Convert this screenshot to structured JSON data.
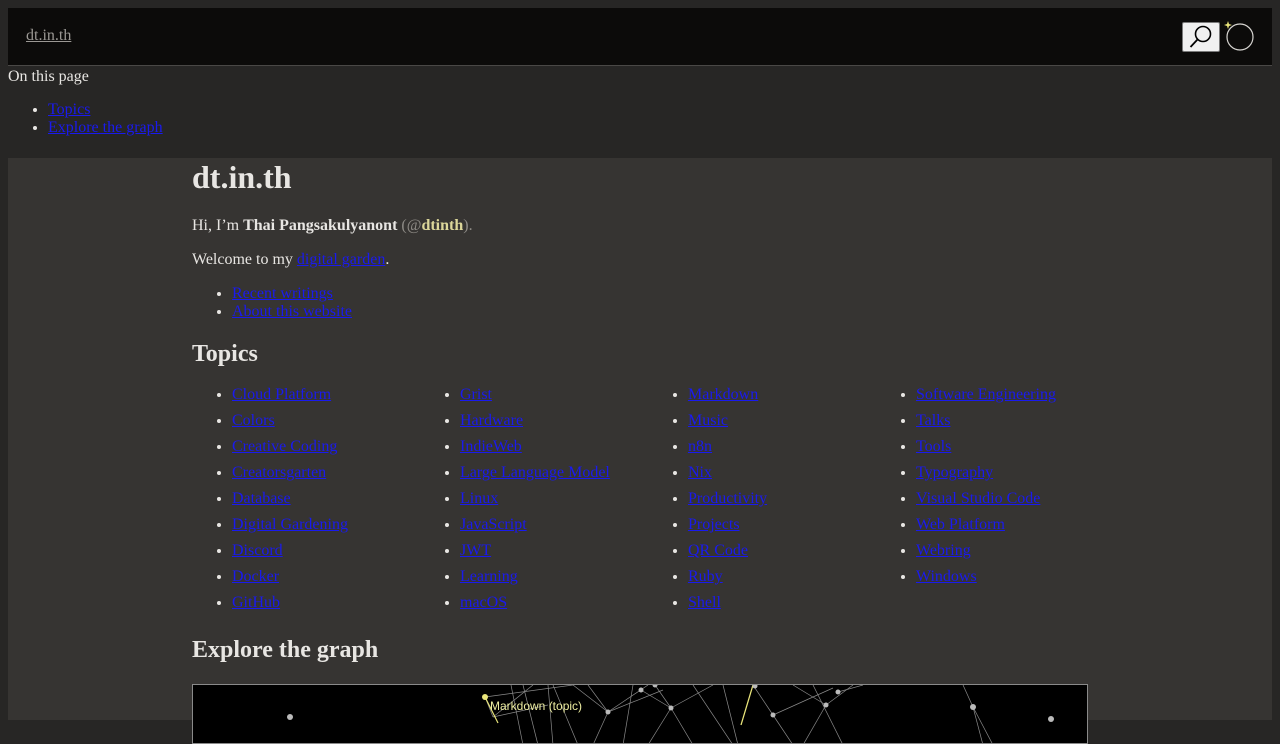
{
  "header": {
    "site_link": "dt.in.th",
    "search_icon": "search-icon",
    "theme_icon": "theme-toggle-icon"
  },
  "toc": {
    "title": "On this page",
    "items": [
      "Topics",
      "Explore the graph"
    ]
  },
  "main": {
    "title": "dt.in.th",
    "intro_prefix": "Hi, I’m",
    "author_name": "Thai Pangsakulyanont",
    "handle_open": "(@",
    "handle": "dtinth",
    "handle_close": ").",
    "welcome_prefix": "Welcome to my",
    "welcome_link": "digital garden",
    "welcome_suffix": ".",
    "links": [
      "Recent writings",
      "About this website"
    ],
    "topics_heading": "Topics",
    "topics": [
      [
        "Cloud Platform",
        "Colors",
        "Creative Coding",
        "Creatorsgarten",
        "Database",
        "Digital Gardening",
        "Discord",
        "Docker",
        "GitHub"
      ],
      [
        "Grist",
        "Hardware",
        "IndieWeb",
        "Large Language Model",
        "Linux",
        "JavaScript",
        "JWT",
        "Learning",
        "macOS"
      ],
      [
        "Markdown",
        "Music",
        "n8n",
        "Nix",
        "Productivity",
        "Projects",
        "QR Code",
        "Ruby",
        "Shell"
      ],
      [
        "Software Engineering",
        "Talks",
        "Tools",
        "Typography",
        "Visual Studio Code",
        "Web Platform",
        "Webring",
        "Windows"
      ]
    ],
    "graph_heading": "Explore the graph",
    "graph_label": "Markdown (topic)"
  },
  "colors": {
    "page_bg": "#272625",
    "main_bg": "#363432",
    "header_bg": "#0c0b0a",
    "link": "#1a1aee",
    "handle": "#dcd79a"
  }
}
